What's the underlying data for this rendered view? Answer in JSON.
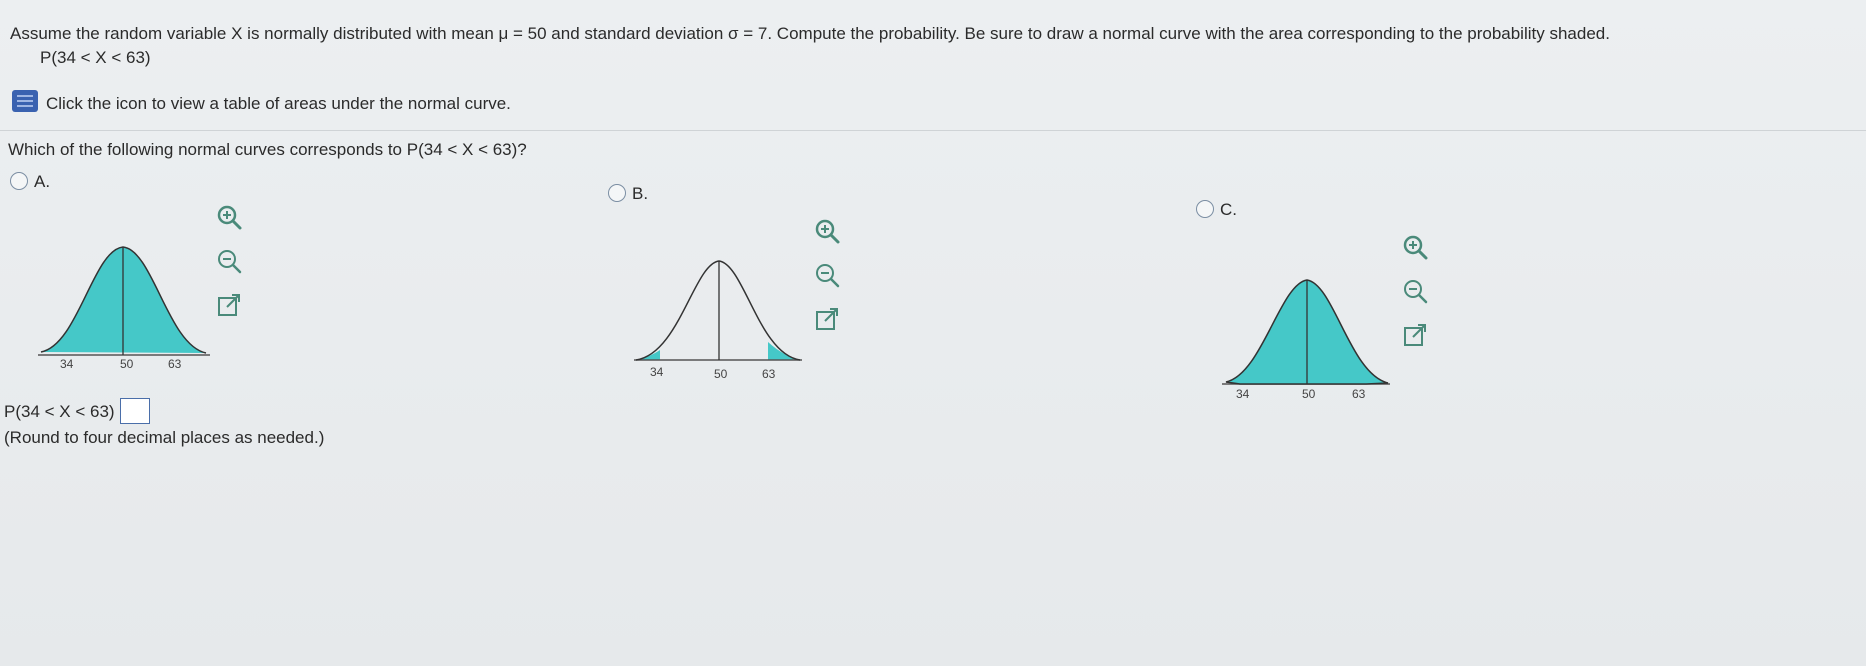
{
  "question": {
    "prompt": "Assume the random variable X is normally distributed with mean μ = 50 and standard deviation σ = 7. Compute the probability. Be sure to draw a normal curve with the area corresponding to the probability shaded.",
    "expression": "P(34 < X < 63)",
    "table_hint": "Click the icon to view a table of areas under the normal curve.",
    "sub_question": "Which of the following normal curves corresponds to P(34 < X < 63)?"
  },
  "options": [
    {
      "label": "A.",
      "ticks": [
        "34",
        "50",
        "63"
      ],
      "shading": "between"
    },
    {
      "label": "B.",
      "ticks": [
        "34",
        "50",
        "63"
      ],
      "shading": "tails"
    },
    {
      "label": "C.",
      "ticks": [
        "34",
        "50",
        "63"
      ],
      "shading": "between"
    }
  ],
  "answer": {
    "label": "P(34 < X < 63) =",
    "value": "",
    "note": "(Round to four decimal places as needed.)"
  },
  "icons": {
    "table": "book-icon",
    "zoom_in": "zoom-in-icon",
    "zoom_out": "zoom-out-icon",
    "popout": "popout-icon"
  },
  "colors": {
    "shade": "#45c8c8",
    "accent": "#3a62b0"
  }
}
